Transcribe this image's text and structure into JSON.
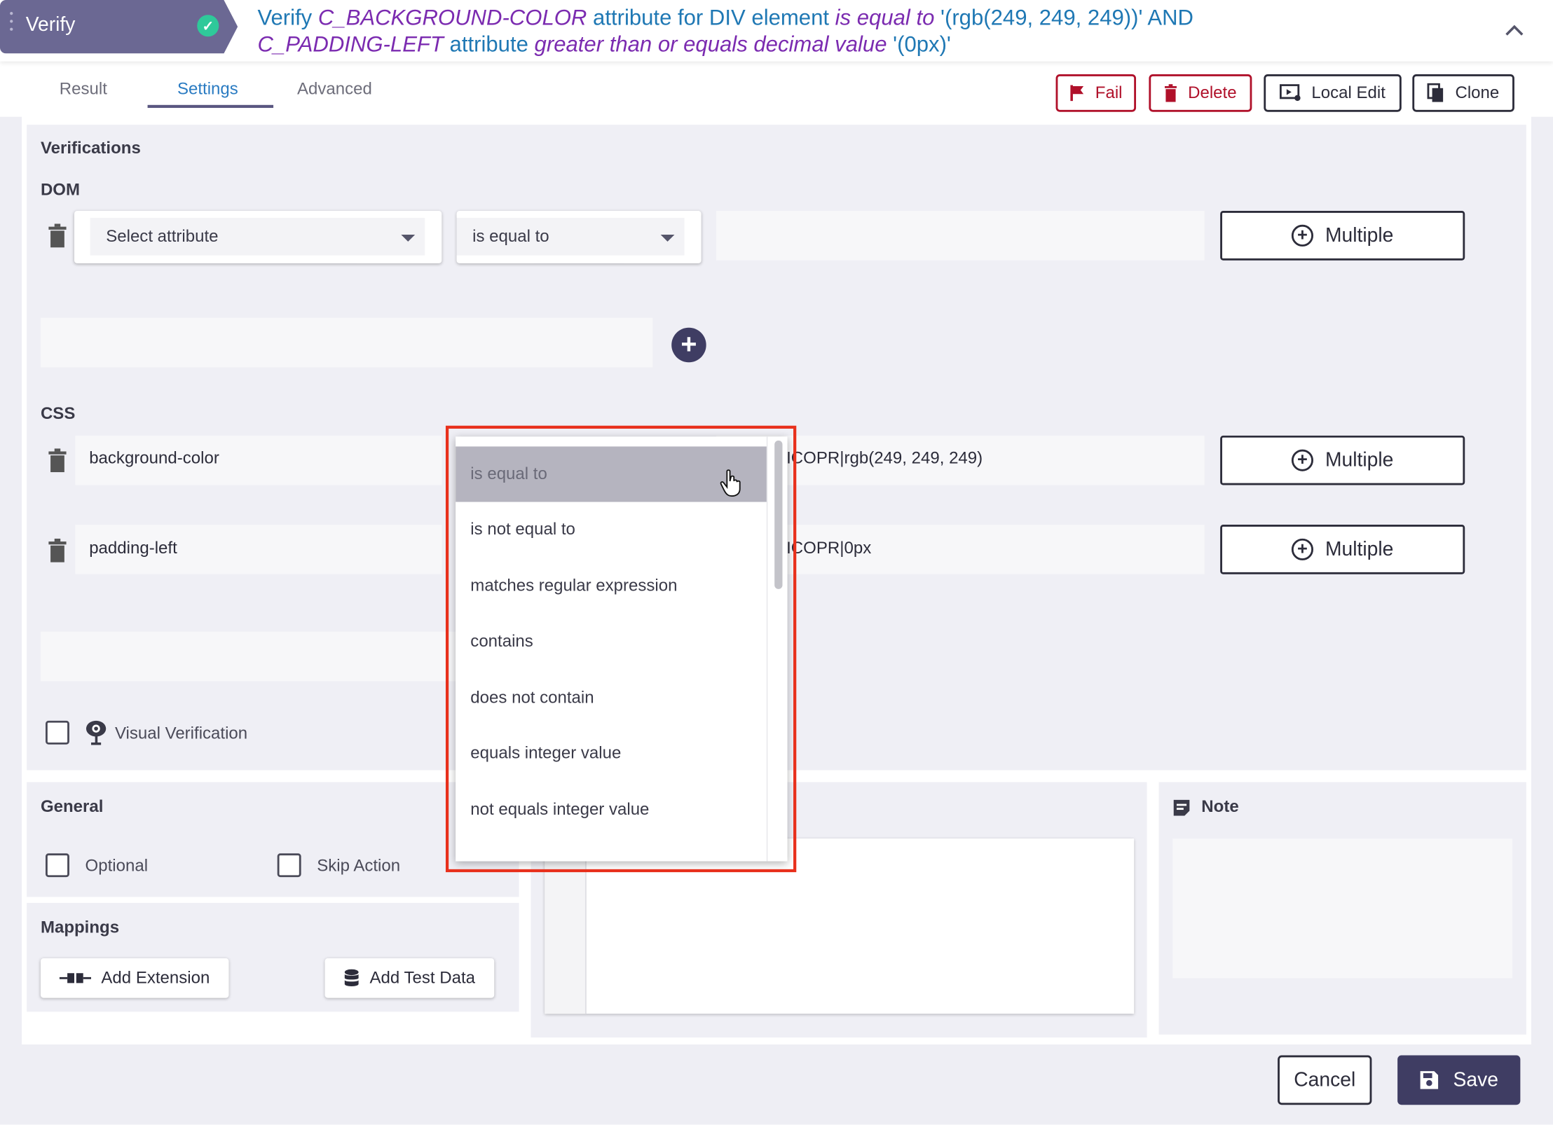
{
  "header": {
    "badge_label": "Verify",
    "summary": {
      "p1": "Verify ",
      "attr1": "C_BACKGROUND-COLOR",
      "p2": " attribute for DIV  element ",
      "op1": "is equal to",
      "p3": "  '(rgb(249, 249, 249))' AND",
      "attr2": "C_PADDING-LEFT",
      "p4": " attribute ",
      "op2": "greater than or equals decimal value",
      "p5": "  '(0px)'"
    }
  },
  "tabs": [
    "Result",
    "Settings",
    "Advanced"
  ],
  "active_tab": "Settings",
  "toolbar": {
    "fail": "Fail",
    "delete": "Delete",
    "local_edit": "Local Edit",
    "clone": "Clone"
  },
  "verifications": {
    "title": "Verifications",
    "dom": {
      "label": "DOM",
      "attribute_placeholder": "Select attribute",
      "operator": "is equal to",
      "multiple": "Multiple"
    },
    "css": {
      "label": "CSS",
      "rows": [
        {
          "attribute": "background-color",
          "value": "ICOPR|rgb(249, 249, 249)",
          "multiple": "Multiple"
        },
        {
          "attribute": "padding-left",
          "value": "ICOPR|0px",
          "multiple": "Multiple"
        }
      ]
    },
    "visual_verification": "Visual Verification"
  },
  "operator_dropdown": {
    "selected": "is equal to",
    "options": [
      "is equal to",
      "is not equal to",
      "matches regular expression",
      "contains",
      "does not contain",
      "equals integer value",
      "not equals integer value"
    ]
  },
  "general": {
    "title": "General",
    "optional": "Optional",
    "skip_action": "Skip Action"
  },
  "mappings": {
    "title": "Mappings",
    "add_extension": "Add Extension",
    "add_test_data": "Add Test Data"
  },
  "note": {
    "title": "Note"
  },
  "footer": {
    "cancel": "Cancel",
    "save": "Save"
  },
  "colors": {
    "accent": "#3f3d63",
    "badge": "#6b6893",
    "danger": "#b0102a",
    "highlight": "#e8301c",
    "success": "#2fc99a"
  }
}
